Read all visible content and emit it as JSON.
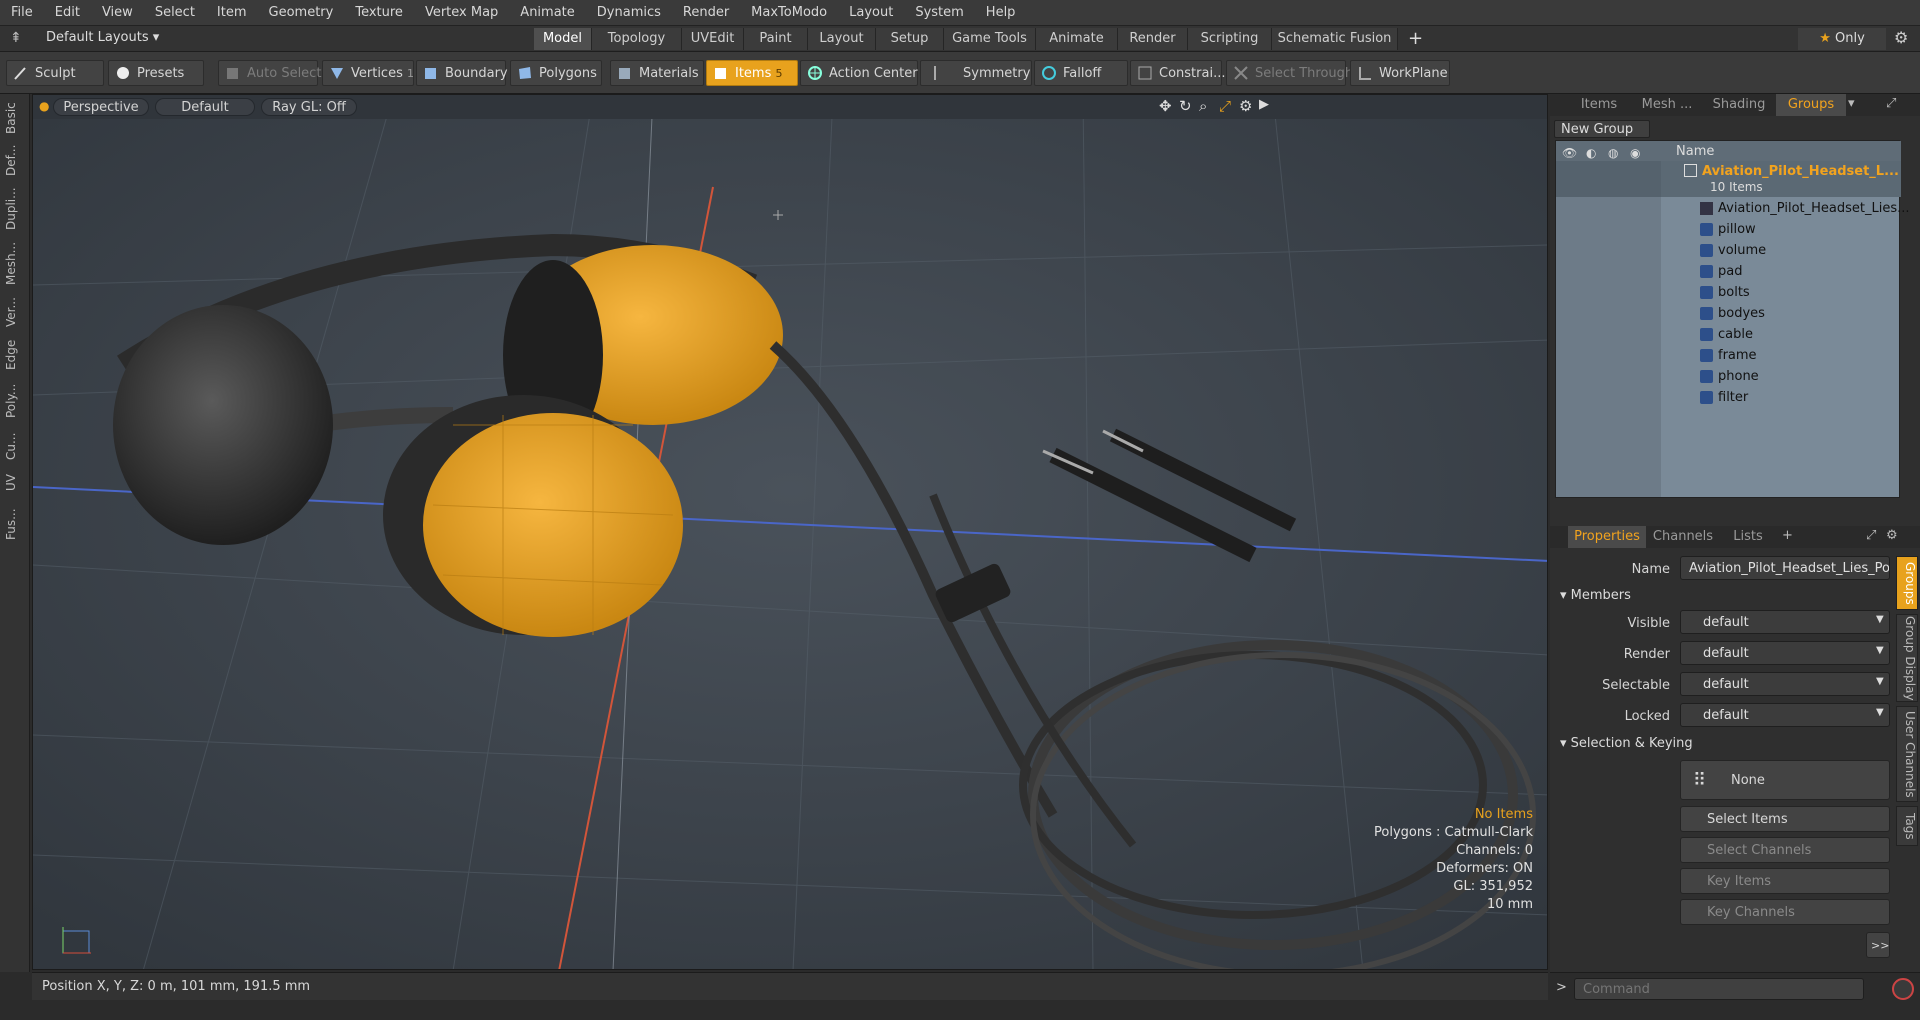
{
  "menu": [
    "File",
    "Edit",
    "View",
    "Select",
    "Item",
    "Geometry",
    "Texture",
    "Vertex Map",
    "Animate",
    "Dynamics",
    "Render",
    "MaxToModo",
    "Layout",
    "System",
    "Help"
  ],
  "layout_selector": "Default Layouts",
  "layout_tabs": [
    "Model",
    "Topology",
    "UVEdit",
    "Paint",
    "Layout",
    "Setup",
    "Game Tools",
    "Animate",
    "Render",
    "Scripting",
    "Schematic Fusion"
  ],
  "active_layout_tab": "Model",
  "only_label": "Only",
  "toolbar": {
    "sculpt": "Sculpt",
    "presets": "Presets",
    "auto_select": "Auto Select",
    "vertices": "Vertices",
    "vertices_count": "1",
    "boundary": "Boundary",
    "polygons": "Polygons",
    "materials": "Materials",
    "items": "Items",
    "items_count": "5",
    "action_center": "Action Center",
    "symmetry": "Symmetry",
    "falloff": "Falloff",
    "constraints": "Constrai...",
    "select_through": "Select Through",
    "workplane": "WorkPlane"
  },
  "left_tabs": [
    "Basic",
    "Def...",
    "Dupli...",
    "Mesh...",
    "Ver...",
    "Edge",
    "Poly...",
    "Cu...",
    "UV",
    "Fus..."
  ],
  "viewport": {
    "view_mode": "Perspective",
    "shading": "Default",
    "raygl": "Ray GL: Off",
    "stats": {
      "selection": "No Items",
      "polygons": "Polygons : Catmull-Clark",
      "channels": "Channels: 0",
      "deformers": "Deformers: ON",
      "gl": "GL: 351,952",
      "scale": "10 mm"
    }
  },
  "status_bar": "Position X, Y, Z:  0 m, 101 mm, 191.5 mm",
  "panel_tabs": [
    "Items",
    "Mesh ...",
    "Shading",
    "Groups"
  ],
  "active_panel_tab": "Groups",
  "new_group_button": "New Group",
  "list_header_name": "Name",
  "group": {
    "name": "Aviation_Pilot_Headset_L...",
    "count": "10 Items",
    "members": [
      "Aviation_Pilot_Headset_Lies...",
      "pillow",
      "volume",
      "pad",
      "bolts",
      "bodyes",
      "cable",
      "frame",
      "phone",
      "filter"
    ]
  },
  "props_tabs": [
    "Properties",
    "Channels",
    "Lists"
  ],
  "properties": {
    "name_label": "Name",
    "name_value": "Aviation_Pilot_Headset_Lies_Pos",
    "members_header": "Members",
    "visible_label": "Visible",
    "visible_value": "default",
    "render_label": "Render",
    "render_value": "default",
    "selectable_label": "Selectable",
    "selectable_value": "default",
    "locked_label": "Locked",
    "locked_value": "default",
    "selection_header": "Selection & Keying",
    "none_button": "None",
    "select_items": "Select Items",
    "select_channels": "Select Channels",
    "key_items": "Key Items",
    "key_channels": "Key Channels",
    "more": ">>"
  },
  "side_tabs": [
    "Groups",
    "Group Display",
    "User Channels",
    "Tags"
  ],
  "command_placeholder": "Command",
  "colors": {
    "accent": "#e8a21d",
    "viewport_bg": "#3a4149",
    "list_bg": "#7a8a98"
  }
}
